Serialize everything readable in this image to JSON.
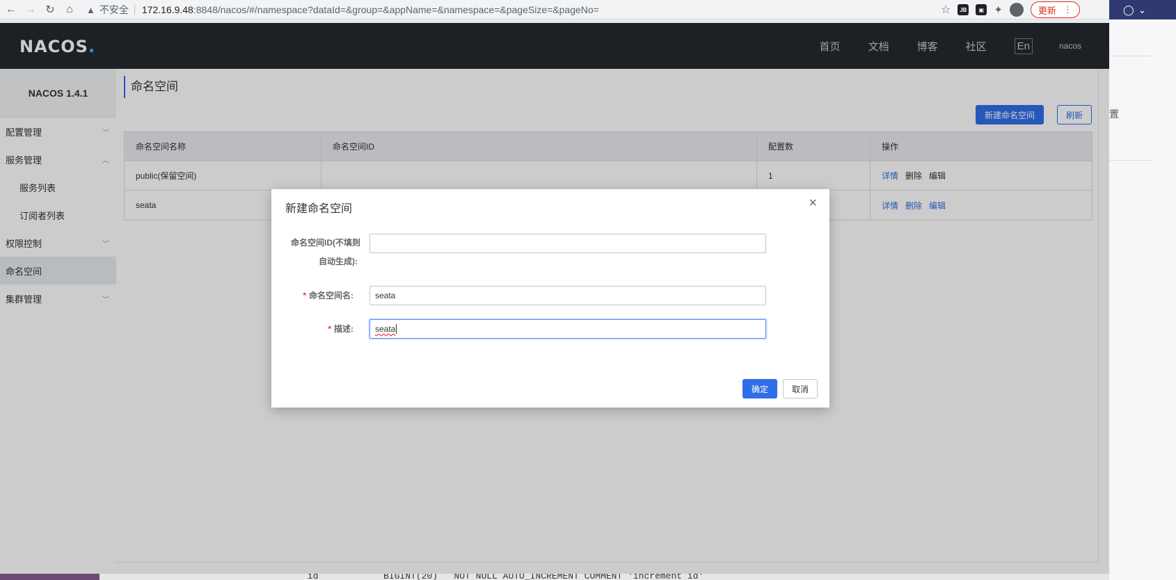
{
  "browser": {
    "insecure_label": "不安全",
    "url_host": "172.16.9.48",
    "url_path": ":8848/nacos/#/namespace?dataId=&group=&appName=&namespace=&pageSize=&pageNo=",
    "update_label": "更新",
    "ext_label": "JB"
  },
  "topnav": {
    "logo": "NACOS",
    "logo_dot": ".",
    "items": [
      "首页",
      "文档",
      "博客",
      "社区"
    ],
    "lang": "En",
    "user": "nacos"
  },
  "sidebar": {
    "version": "NACOS 1.4.1",
    "items": [
      {
        "label": "配置管理"
      },
      {
        "label": "服务管理"
      },
      {
        "label": "服务列表"
      },
      {
        "label": "订阅者列表"
      },
      {
        "label": "权限控制"
      },
      {
        "label": "命名空间"
      },
      {
        "label": "集群管理"
      }
    ]
  },
  "main": {
    "title": "命名空间",
    "new_button": "新建命名空间",
    "refresh_button": "刷新",
    "columns": [
      "命名空间名称",
      "命名空间ID",
      "配置数",
      "操作"
    ],
    "rows": [
      {
        "name": "public(保留空间)",
        "id": "",
        "count": "1",
        "ops": [
          "详情",
          "删除",
          "编辑"
        ]
      },
      {
        "name": "seata",
        "id": "",
        "count": "",
        "ops": [
          "详情",
          "删除",
          "编辑"
        ]
      }
    ]
  },
  "dialog": {
    "title": "新建命名空间",
    "close": "×",
    "id_label_line1": "命名空间ID(不填则",
    "id_label_line2": "自动生成):",
    "id_value": "",
    "name_label": "命名空间名:",
    "name_value": "seata",
    "desc_label": "描述:",
    "desc_value": "seata",
    "required_mark": "*",
    "ok": "确定",
    "cancel": "取消"
  },
  "background": {
    "right_text": "置",
    "editor_line": "`id`           BIGINT(20)   NOT NULL AUTO_INCREMENT COMMENT 'increment id'"
  },
  "colors": {
    "primary": "#2f6ee8",
    "nav_bg": "#252a2f",
    "required": "#e73c3c"
  }
}
